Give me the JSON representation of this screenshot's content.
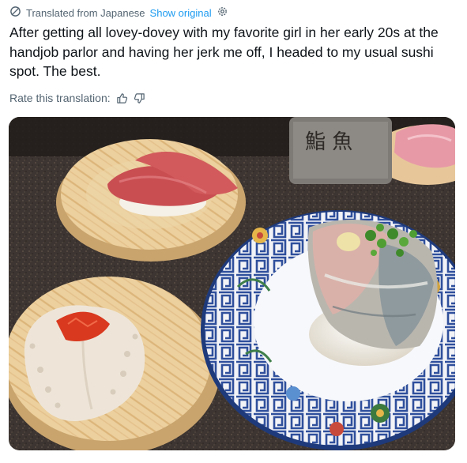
{
  "translation": {
    "label": "Translated from Japanese",
    "show_original": "Show original",
    "icons": [
      "translate-icon",
      "gear-icon"
    ]
  },
  "post": {
    "text": "After getting all lovey-dovey with my favorite girl in her early 20s at the handjob parlor and having her jerk me off, I headed to my usual sushi spot. The best."
  },
  "rating": {
    "label": "Rate this translation:",
    "icons": [
      "thumbs-up-icon",
      "thumbs-down-icon"
    ]
  },
  "photo": {
    "kanji_on_cup": "鮨 魚",
    "colors": {
      "counter": "#3a3330",
      "wood_plate": "#e9c994",
      "blue_pattern": "#2f4f9c",
      "tuna": "#c94e52",
      "octopus": "#eee5d8",
      "roe": "#d9391f",
      "mackerel": "#b9b6ae",
      "scallion": "#3f8a2b"
    }
  }
}
